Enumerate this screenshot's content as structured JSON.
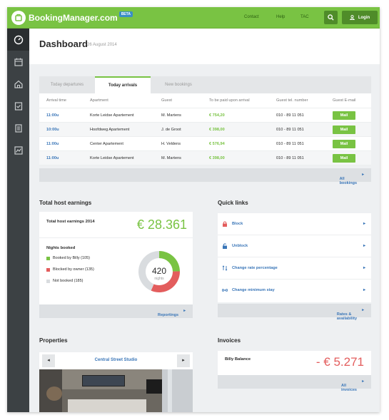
{
  "app": {
    "name": "BookingManager.com",
    "beta": "BETA"
  },
  "nav": {
    "contact": "Contact",
    "help": "Help",
    "tac": "TAC",
    "login": "Login"
  },
  "page": {
    "title": "Dashboard",
    "date": "26 August 2014"
  },
  "tabs": [
    "Today departures",
    "Today arrivals",
    "New bookings"
  ],
  "table": {
    "headers": [
      "Arrival time",
      "Apartment",
      "Guest",
      "To be paid upon arrival",
      "Guest tel. number",
      "Guest E-mail"
    ],
    "rows": [
      {
        "time": "11:00u",
        "apartment": "Korte Leidse Apartement",
        "guest": "M. Martens",
        "pay": "€ 754,20",
        "tel": "010 - 89 11 051",
        "mail": "Mail"
      },
      {
        "time": "10:00u",
        "apartment": "Hoofdweg Apartement",
        "guest": "J. de Groot",
        "pay": "€ 398,00",
        "tel": "010 - 89 11 051",
        "mail": "Mail"
      },
      {
        "time": "11:00u",
        "apartment": "Center Apartement",
        "guest": "H. Veldens",
        "pay": "€ 576,94",
        "tel": "010 - 89 11 051",
        "mail": "Mail"
      },
      {
        "time": "11:00u",
        "apartment": "Korte Leidse Apartement",
        "guest": "M. Martens",
        "pay": "€ 398,00",
        "tel": "010 - 89 11 051",
        "mail": "Mail"
      }
    ],
    "footer": "All bookings"
  },
  "earnings": {
    "heading": "Total host earnings",
    "label": "Total host earnings 2014",
    "amount": "€ 28.361",
    "nights_title": "Nights booked",
    "legend": [
      {
        "label": "Booked by Billy (105)",
        "color": "#79c343",
        "value": 105
      },
      {
        "label": "Blocked by owner (135)",
        "color": "#e35d5d",
        "value": 135
      },
      {
        "label": "Not booked (185)",
        "color": "#d9dcdf",
        "value": 185
      }
    ],
    "donut_value": "420",
    "donut_label": "nights",
    "footer": "Reportings"
  },
  "quicklinks": {
    "heading": "Quick links",
    "items": [
      "Block",
      "Unblock",
      "Change rate percentage",
      "Change minimum stay"
    ],
    "footer": "Rates & availability"
  },
  "properties": {
    "heading": "Properties",
    "name": "Central Street Studio"
  },
  "invoices": {
    "heading": "Invoices",
    "label": "Billy Balance",
    "amount": "- € 5.271",
    "footer": "All invoices"
  },
  "colors": {
    "brand": "#79c343",
    "link": "#3a76b8",
    "negative": "#e35d5d",
    "sidebar": "#3c4144"
  }
}
